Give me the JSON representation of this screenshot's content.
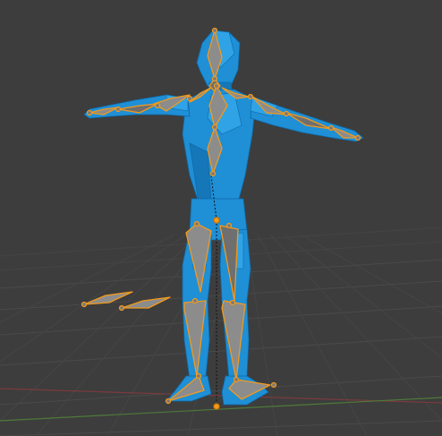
{
  "viewport": {
    "background_color": "#3d3d3d",
    "grid_color": "#4a4a4a",
    "axis_x_color": "#7a3a3e",
    "axis_y_color": "#4d7a3a",
    "mesh_color": "#1f8fd6",
    "bone_fill_color": "#8c8c8c",
    "bone_outline_color": "#f29a1c"
  }
}
